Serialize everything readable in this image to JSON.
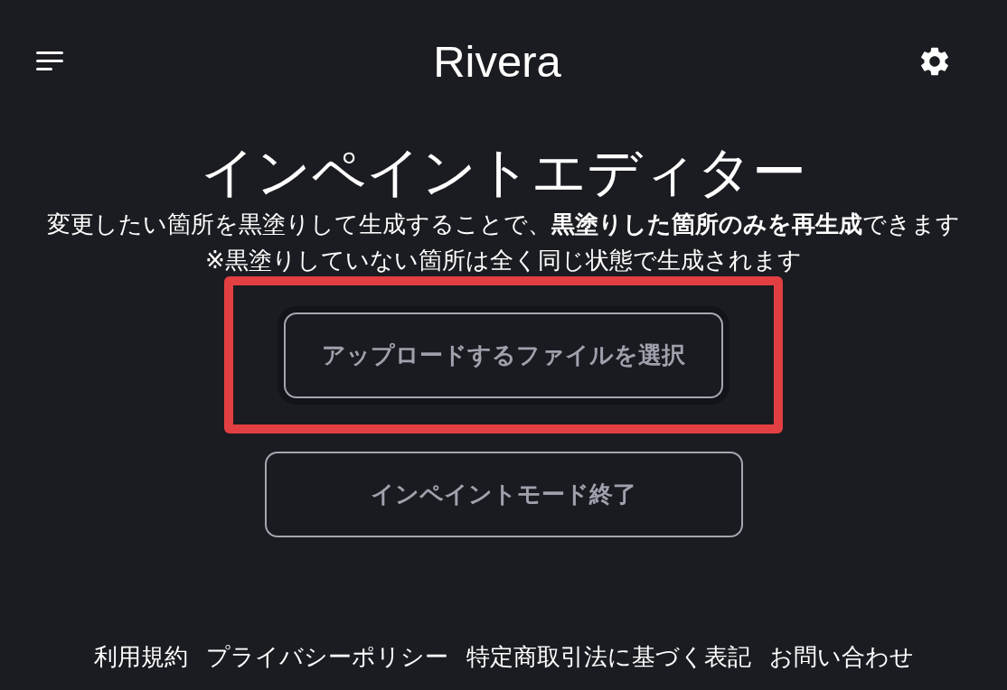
{
  "header": {
    "title": "Rivera"
  },
  "editor": {
    "title": "インペイントエディター",
    "description": "変更したい箇所を黒塗りして生成することで、**黒塗りした箇所のみを再生成**できます",
    "note": "※黒塗りしていない箇所は全く同じ状態で生成されます"
  },
  "buttons": [
    {
      "label": "アップロードするファイルを選択",
      "highlighted": true,
      "focused": true
    },
    {
      "label": "インペイントモード終了",
      "highlighted": false,
      "focused": false
    }
  ],
  "footer_links": [
    "利用規約",
    "プライバシーポリシー",
    "特定商取引法に基づく表記",
    "お問い合わせ"
  ]
}
